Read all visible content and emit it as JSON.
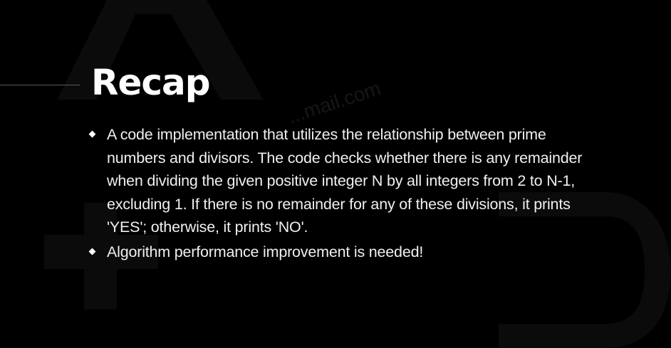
{
  "slide": {
    "title": "Recap",
    "watermark_text": "...mail.com",
    "bullets": [
      {
        "text": "A code implementation that utilizes the relationship between prime numbers and divisors. The code checks whether there is any remainder when dividing the given positive integer N by all integers from 2 to N-1, excluding 1. If there is no remainder for any of these divisions, it prints 'YES'; otherwise, it prints 'NO'."
      },
      {
        "text": "Algorithm performance improvement is needed!"
      }
    ]
  },
  "colors": {
    "background": "#000000",
    "text": "#ffffff",
    "background_shapes": "#0b0b0b"
  },
  "icons": {
    "bullet": "diamond-bullet-icon"
  }
}
